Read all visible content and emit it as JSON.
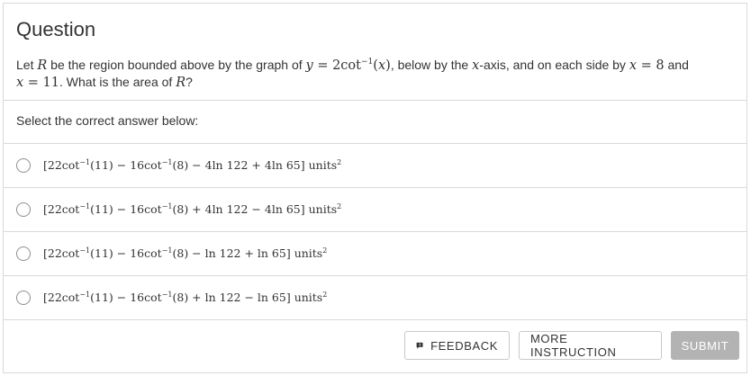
{
  "question": {
    "title": "Question",
    "text_prefix": "Let ",
    "text_var_R": "R",
    "text_middle1": " be the region bounded above by the graph of ",
    "text_eq1": "y = 2cot",
    "text_eq1_sup": "−1",
    "text_eq1_arg": "(x)",
    "text_middle2": ", below by the ",
    "text_var_x": "x",
    "text_middle3": "-axis, and on each side by ",
    "text_eq2": "x = 8",
    "text_middle4": " and ",
    "text_eq3": "x = 11",
    "text_middle5": ". What is the area of ",
    "text_var_R2": "R",
    "text_suffix": "?"
  },
  "prompt": "Select the correct answer below:",
  "options": [
    {
      "a": "[22cot",
      "b": "−1",
      "c": "(11) − 16cot",
      "d": "−1",
      "e": "(8) − 4ln 122 + 4ln 65] units",
      "f": "2"
    },
    {
      "a": "[22cot",
      "b": "−1",
      "c": "(11) − 16cot",
      "d": "−1",
      "e": "(8) + 4ln 122 − 4ln 65] units",
      "f": "2"
    },
    {
      "a": "[22cot",
      "b": "−1",
      "c": "(11) − 16cot",
      "d": "−1",
      "e": "(8) − ln 122 + ln 65] units",
      "f": "2"
    },
    {
      "a": "[22cot",
      "b": "−1",
      "c": "(11) − 16cot",
      "d": "−1",
      "e": "(8) + ln 122 − ln 65] units",
      "f": "2"
    }
  ],
  "buttons": {
    "feedback": "FEEDBACK",
    "more_instruction": "MORE INSTRUCTION",
    "submit": "SUBMIT"
  },
  "colors": {
    "border": "#d9d9d9",
    "submit_bg": "#b3b3b3",
    "text": "#333333"
  }
}
